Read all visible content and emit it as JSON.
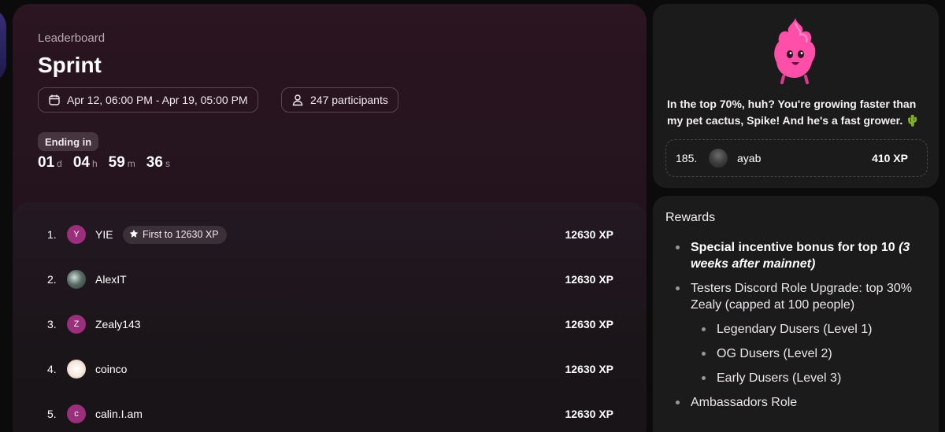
{
  "header": {
    "section": "Leaderboard",
    "title": "Sprint",
    "date_range": "Apr 12, 06:00 PM - Apr 19, 05:00 PM",
    "participants": "247 participants",
    "ending_label": "Ending in",
    "countdown": {
      "days": "01",
      "days_unit": "d",
      "hours": "04",
      "hours_unit": "h",
      "minutes": "59",
      "minutes_unit": "m",
      "seconds": "36",
      "seconds_unit": "s"
    }
  },
  "leaderboard": {
    "rows": [
      {
        "rank": "1.",
        "initial": "Y",
        "name": "YIE",
        "badge": "First to 12630 XP",
        "xp": "12630 XP"
      },
      {
        "rank": "2.",
        "initial": "",
        "name": "AlexIT",
        "xp": "12630 XP"
      },
      {
        "rank": "3.",
        "initial": "Z",
        "name": "Zealy143",
        "xp": "12630 XP"
      },
      {
        "rank": "4.",
        "initial": "",
        "name": "coinco",
        "xp": "12630 XP"
      },
      {
        "rank": "5.",
        "initial": "c",
        "name": "calin.I.am",
        "xp": "12630 XP"
      }
    ]
  },
  "sidebar": {
    "mascot_icon": "pink-flame-mascot-icon",
    "quote": "In the top 70%, huh? You're growing faster than my pet cactus, Spike! And he's a fast grower. 🌵",
    "me": {
      "rank": "185.",
      "name": "ayab",
      "xp": "410 XP"
    }
  },
  "rewards": {
    "title": "Rewards",
    "item1_bold": "Special incentive bonus for top 10 ",
    "item1_italic": "(3 weeks after mainnet)",
    "item2": "Testers Discord Role Upgrade: top 30% Zealy (capped at 100 people)",
    "sub_items": [
      "Legendary Dusers (Level 1)",
      "OG Dusers (Level 2)",
      "Early Dusers (Level 3)"
    ],
    "item3": "Ambassadors Role"
  },
  "colors": {
    "accent_pink": "#9b2f7b",
    "card_bg": "#2a1520",
    "panel_bg": "#1c1b1c"
  }
}
